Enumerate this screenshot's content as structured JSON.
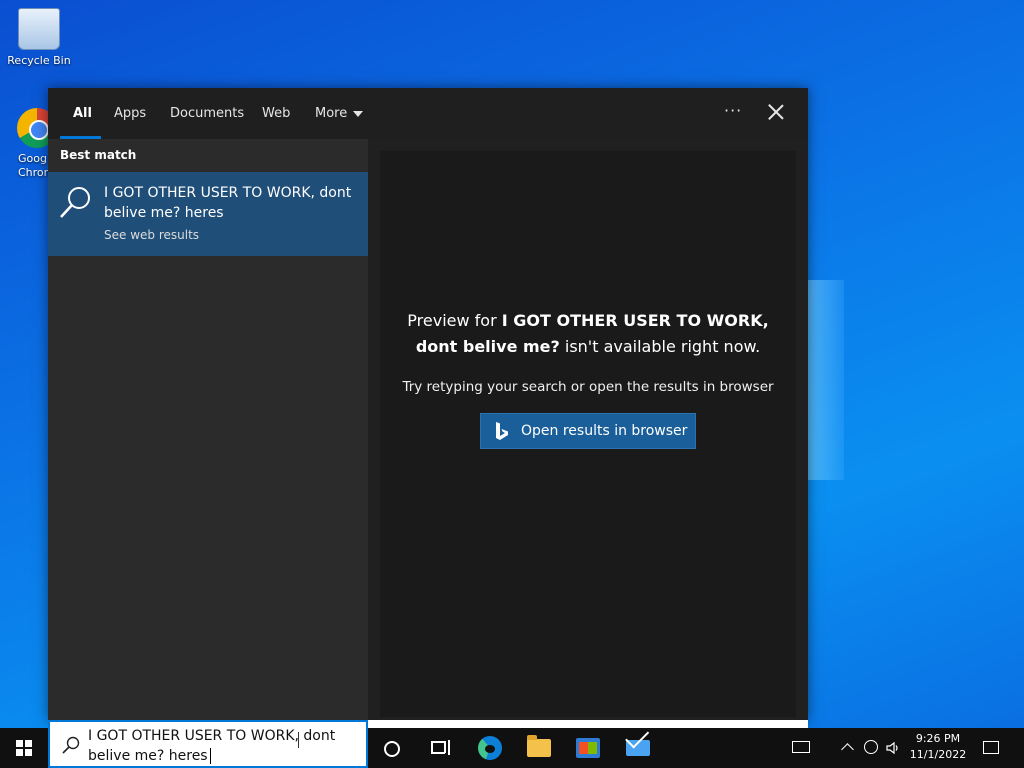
{
  "desktop": {
    "icons": [
      {
        "label": "Recycle Bin",
        "icon": "recycle-bin-icon"
      },
      {
        "label": "Goog\nChron",
        "icon": "google-chrome-icon"
      }
    ]
  },
  "search_window": {
    "tabs": [
      {
        "label": "All",
        "active": true
      },
      {
        "label": "Apps"
      },
      {
        "label": "Documents"
      },
      {
        "label": "Web"
      },
      {
        "label": "More"
      }
    ],
    "options_label": "···",
    "best_match_label": "Best match",
    "result": {
      "title": "I GOT OTHER USER TO WORK, dont belive me? heres",
      "subtitle": "See web results",
      "icon": "search-icon"
    },
    "preview": {
      "prefix": "Preview for ",
      "query_line1": "I GOT OTHER USER TO WORK,",
      "query_line2": "dont belive me?",
      "suffix": " isn't available right now.",
      "hint": "Try retyping your search or open the results in browser",
      "button_label": "Open results in browser",
      "button_icon": "bing-icon"
    }
  },
  "taskbar": {
    "search_text": "I GOT OTHER USER TO WORK, dont belive me? heres",
    "apps": [
      "cortana-icon",
      "task-view-icon",
      "edge-icon",
      "file-explorer-icon",
      "microsoft-store-icon",
      "mail-icon"
    ],
    "clock": {
      "time": "9:26 PM",
      "date": "11/1/2022"
    }
  },
  "colors": {
    "accent": "#0078d7",
    "selected_result": "#1f4e79",
    "button": "#1a5f99"
  }
}
